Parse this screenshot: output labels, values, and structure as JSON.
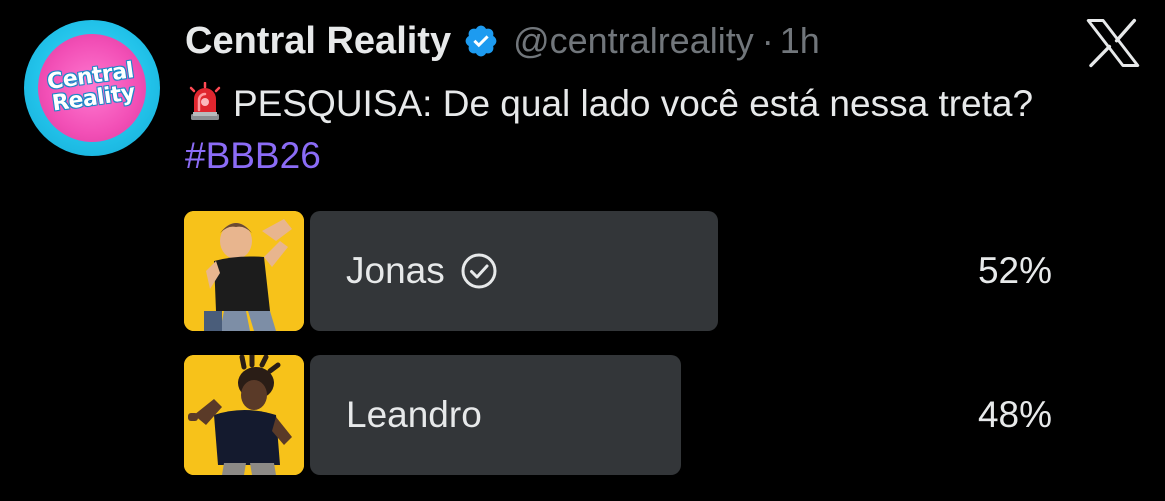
{
  "author": {
    "avatar_text_line1": "Central",
    "avatar_text_line2": "Reality",
    "display_name": "Central Reality",
    "handle": "@centralreality",
    "separator": "·",
    "time": "1h",
    "verified": true
  },
  "tweet": {
    "emoji": "rotating-light-siren",
    "text": "PESQUISA: De qual lado você está nessa treta?",
    "hashtag": "#BBB26"
  },
  "poll": {
    "options": [
      {
        "label": "Jonas",
        "percent_text": "52%",
        "percent": 52,
        "winner": true
      },
      {
        "label": "Leandro",
        "percent_text": "48%",
        "percent": 48,
        "winner": false
      }
    ]
  },
  "colors": {
    "background": "#000000",
    "text": "#e7e9ea",
    "muted": "#71767b",
    "hashtag": "#8b6cf6",
    "verified": "#1d9bf0",
    "poll_bar": "#333639",
    "poll_image_bg": "#f7c21a"
  },
  "icons": {
    "brand": "x-logo-icon",
    "verified": "verified-badge-icon",
    "winner": "check-circle-icon"
  }
}
